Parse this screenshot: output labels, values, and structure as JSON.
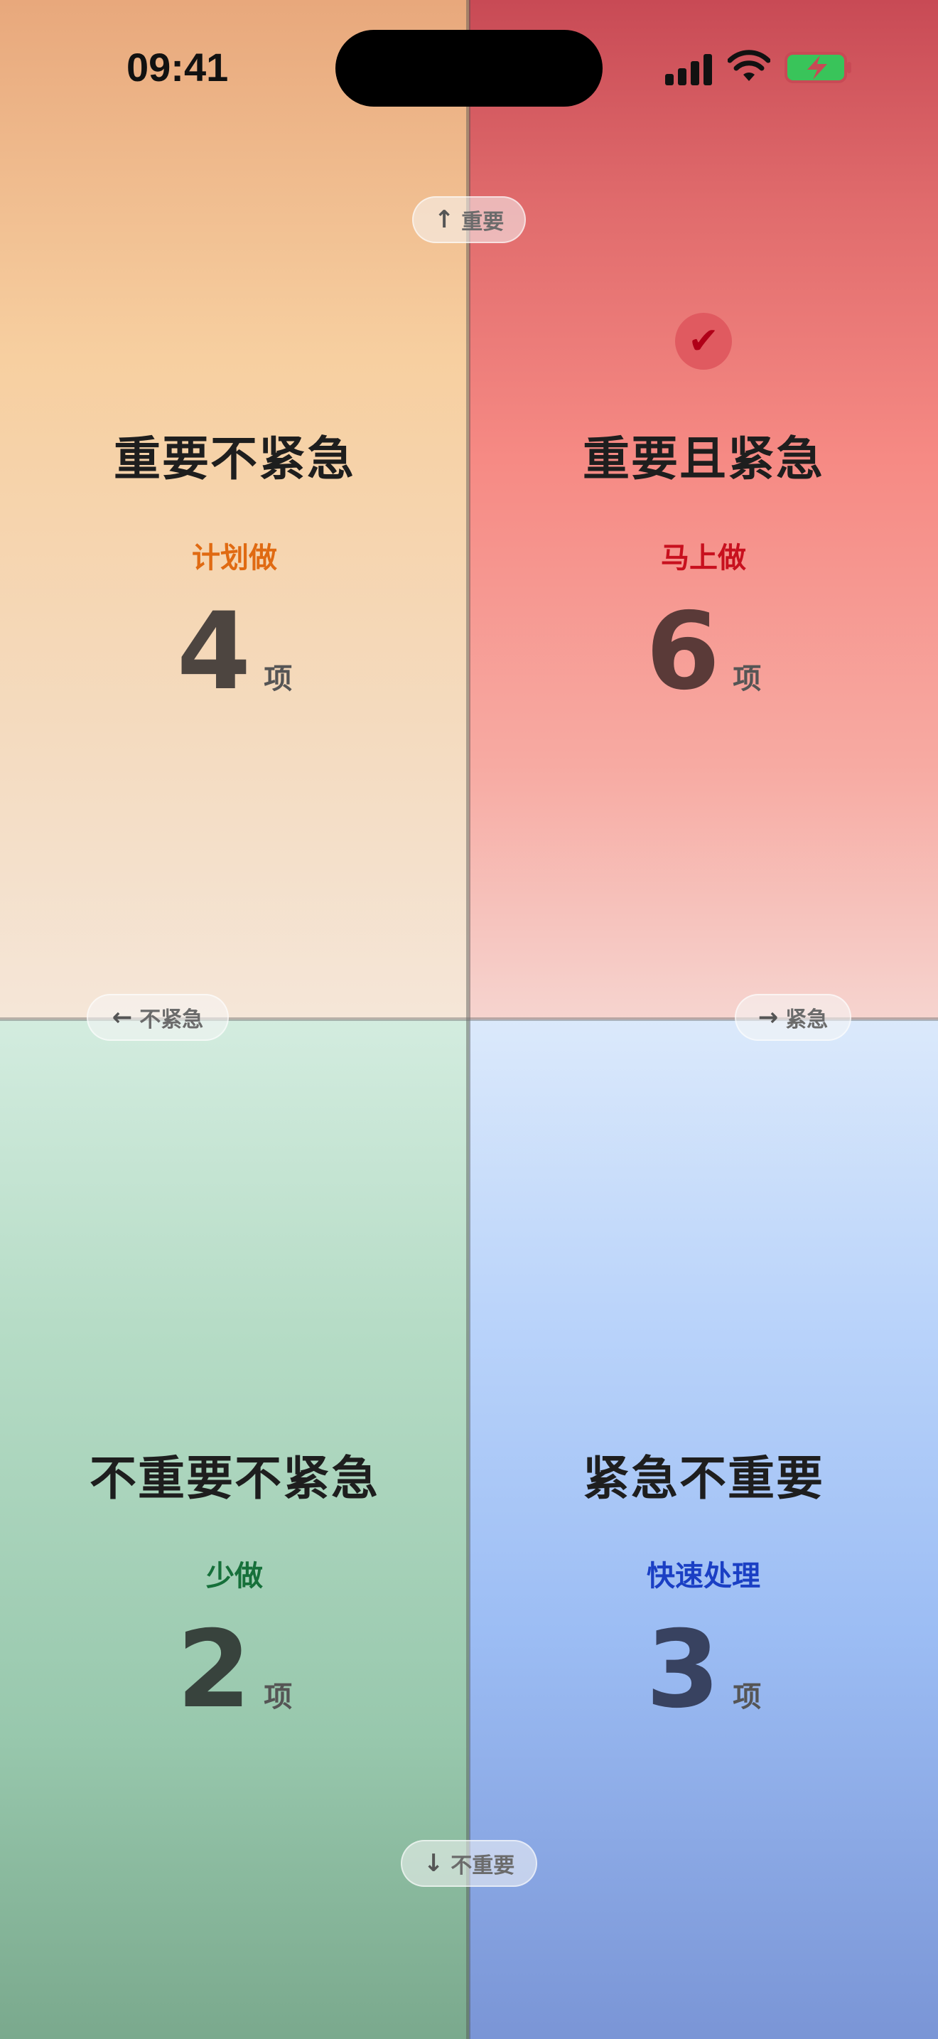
{
  "status": {
    "time": "09:41"
  },
  "axes": {
    "up": "重要",
    "left": "不紧急",
    "right": "紧急",
    "down": "不重要"
  },
  "quadrants": {
    "top_left": {
      "title": "重要不紧急",
      "action": "计划做",
      "count": "4",
      "unit": "项",
      "action_color": "#e06a12",
      "count_color": "#4d4540"
    },
    "top_right": {
      "title": "重要且紧急",
      "action": "马上做",
      "count": "6",
      "unit": "项",
      "action_color": "#c8101e",
      "count_color": "#5a3a38",
      "selected": true
    },
    "bottom_left": {
      "title": "不重要不紧急",
      "action": "少做",
      "count": "2",
      "unit": "项",
      "action_color": "#16703a",
      "count_color": "#38433d"
    },
    "bottom_right": {
      "title": "紧急不重要",
      "action": "快速处理",
      "count": "3",
      "unit": "项",
      "action_color": "#1a3fc4",
      "count_color": "#384260"
    }
  },
  "icons": {
    "up": "arrow-up-icon",
    "left": "arrow-left-icon",
    "right": "arrow-right-icon",
    "down": "arrow-down-icon",
    "selected": "checkmark-icon"
  }
}
